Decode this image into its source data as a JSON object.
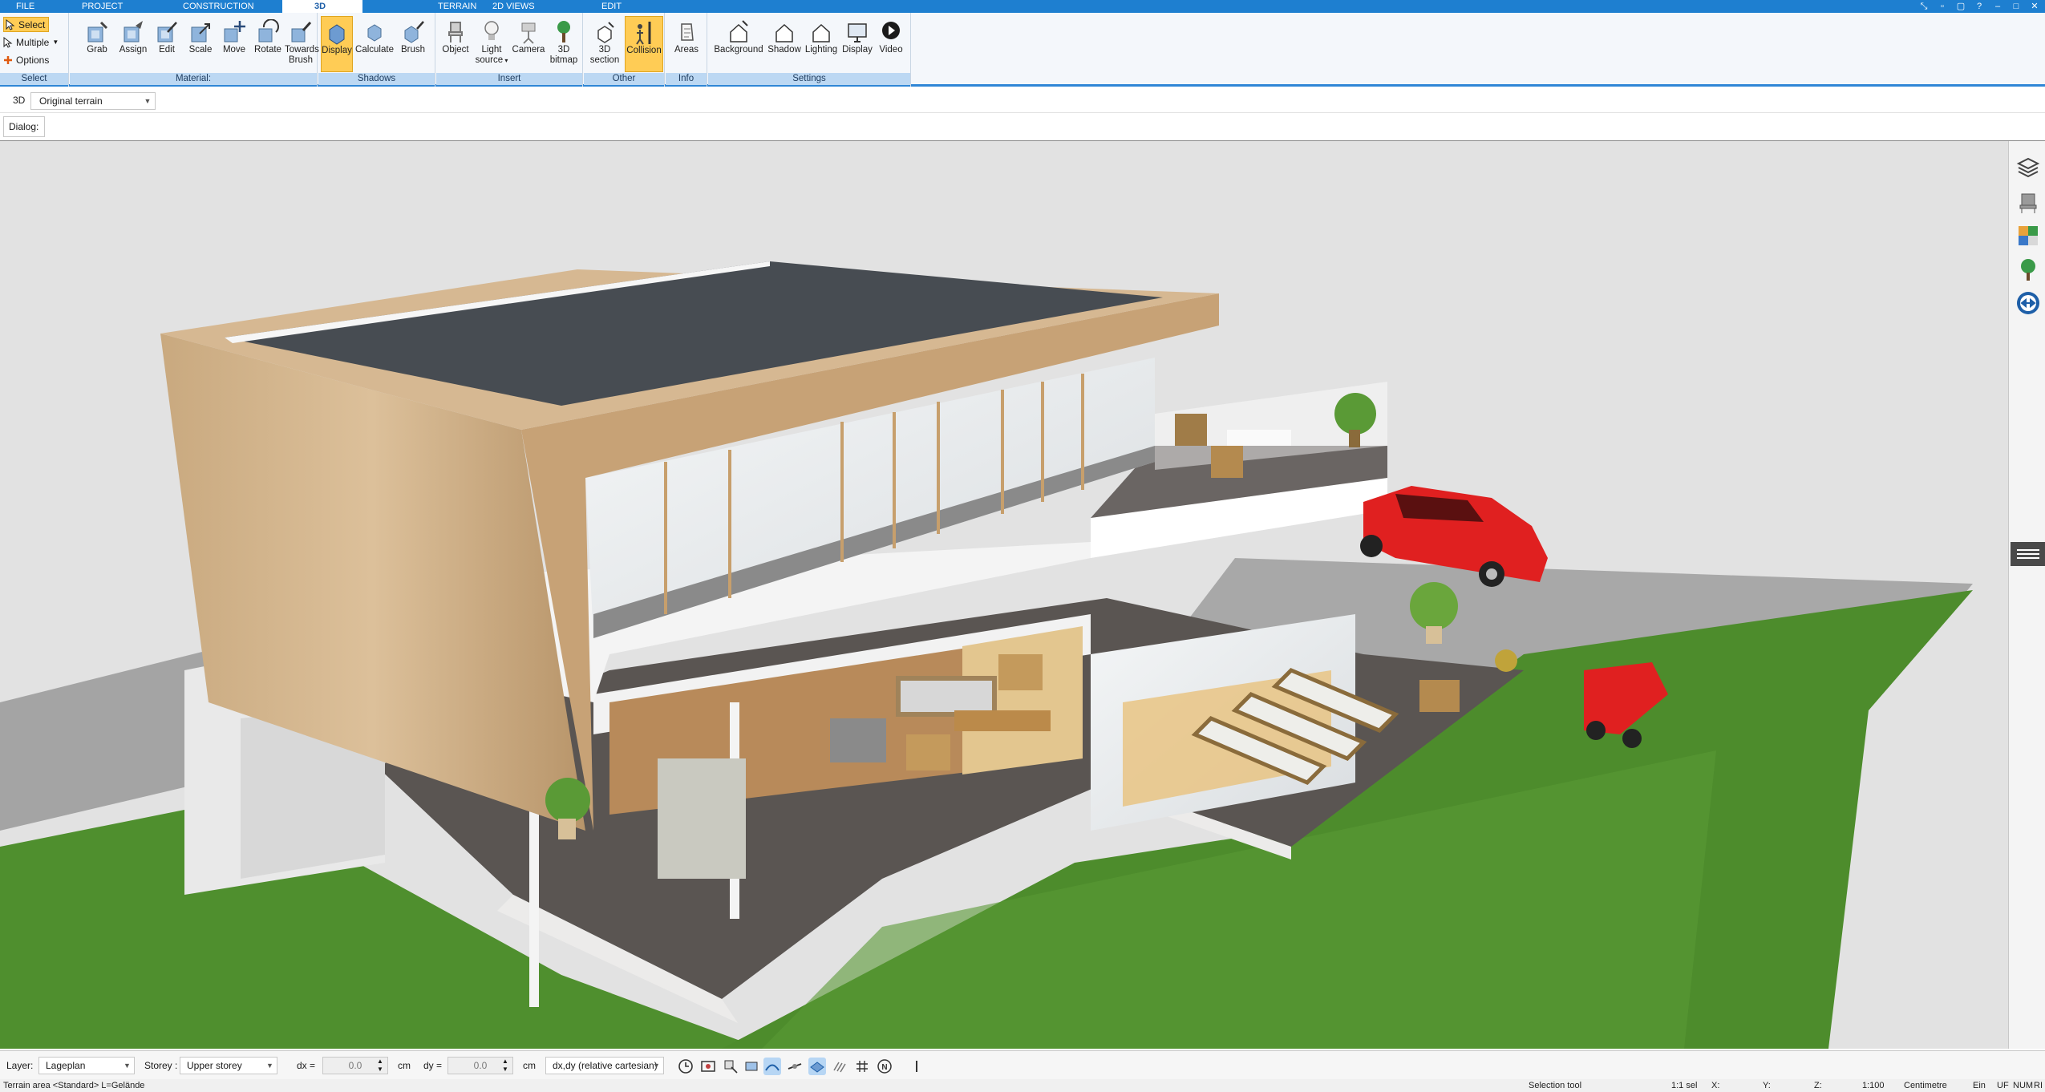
{
  "tabs": [
    {
      "label": "FILE",
      "active": false
    },
    {
      "label": "PROJECT",
      "active": false
    },
    {
      "label": "CONSTRUCTION",
      "active": false
    },
    {
      "label": "3D",
      "active": true
    },
    {
      "label": "TERRAIN",
      "active": false
    },
    {
      "label": "2D VIEWS",
      "active": false
    },
    {
      "label": "EDIT",
      "active": false
    }
  ],
  "ribbon": {
    "select_group": {
      "label": "Select",
      "select": "Select",
      "multiple": "Multiple",
      "options": "Options"
    },
    "material_group": {
      "label": "Material:",
      "buttons": [
        "Grab",
        "Assign",
        "Edit",
        "Scale",
        "Move",
        "Rotate",
        "Towards Brush"
      ]
    },
    "shadows_group": {
      "label": "Shadows",
      "buttons": [
        "Display",
        "Calculate",
        "Brush"
      ]
    },
    "insert_group": {
      "label": "Insert",
      "buttons": [
        "Object",
        "Light source",
        "Camera",
        "3D bitmap"
      ]
    },
    "other_group": {
      "label": "Other",
      "buttons": [
        "3D section",
        "Collision"
      ]
    },
    "info_group": {
      "label": "Info",
      "buttons": [
        "Areas"
      ]
    },
    "settings_group": {
      "label": "Settings",
      "buttons": [
        "Background",
        "Shadow",
        "Lighting",
        "Display",
        "Video"
      ]
    }
  },
  "viewbar": {
    "view_label": "3D",
    "terrain_value": "Original terrain",
    "dialog_label": "Dialog:"
  },
  "bottombar": {
    "layer_label": "Layer:",
    "layer_value": "Lageplan",
    "storey_label": "Storey :",
    "storey_value": "Upper storey",
    "dx_label": "dx =",
    "dx_value": "0.0",
    "dx_unit": "cm",
    "dy_label": "dy =",
    "dy_value": "0.0",
    "dy_unit": "cm",
    "coord_mode": "dx,dy (relative cartesian)"
  },
  "statusline": {
    "left": "Terrain area <Standard> L=Gelände",
    "tool": "Selection tool",
    "sel": "1:1 sel",
    "x": "X:",
    "y": "Y:",
    "z": "Z:",
    "scale": "1:100",
    "unit": "Centimetre",
    "ein": "Ein",
    "uf": "UF",
    "num": "NUM",
    "ri": "RI"
  },
  "colors": {
    "accent": "#1e7fd0",
    "ribbon_group_label": "#bcd8f3",
    "active_toggle": "#ffcc55",
    "grass": "#4f8f2e",
    "deck": "#5a5552",
    "car": "#e02020"
  }
}
